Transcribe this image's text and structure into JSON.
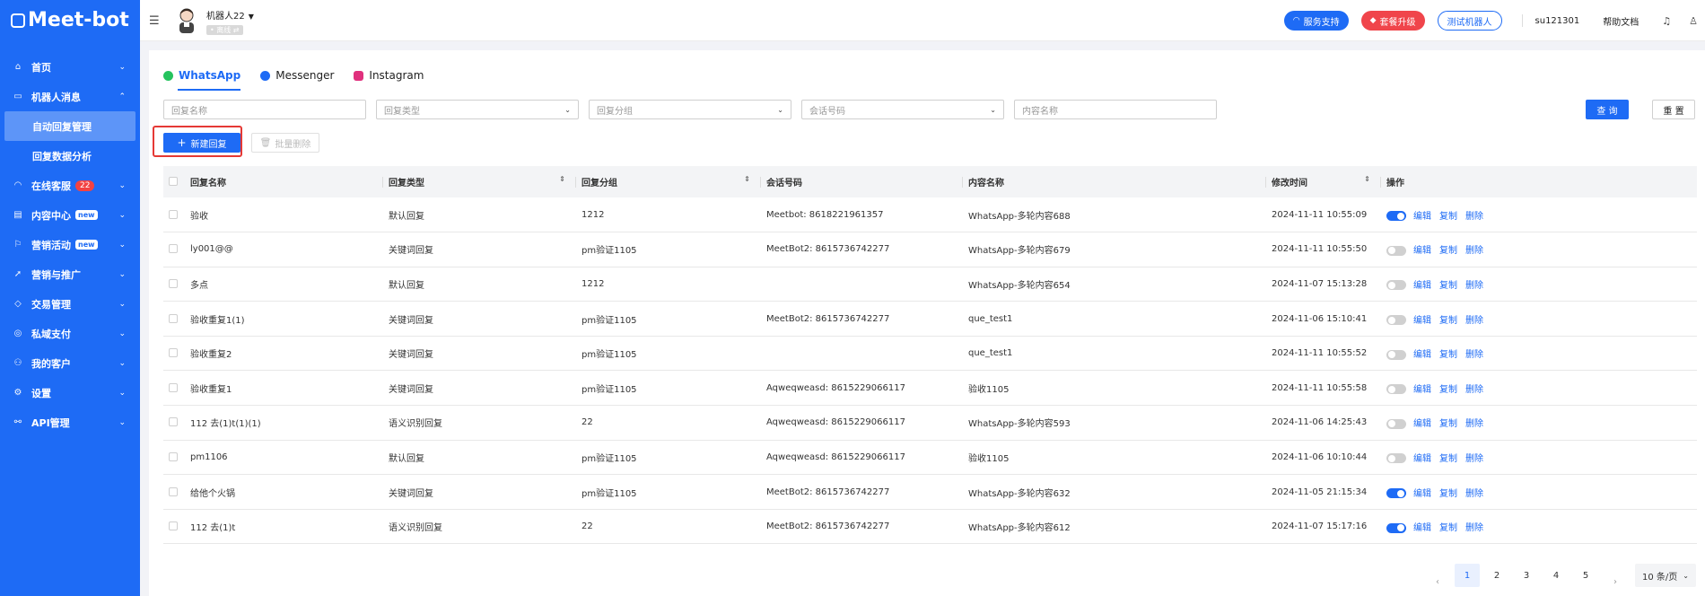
{
  "app": {
    "logo_text": "Meet-bot"
  },
  "sidebar": {
    "items": [
      {
        "label": "首页",
        "icon": "home-icon",
        "glyph": "⌂",
        "chev": "⌄"
      },
      {
        "label": "机器人消息",
        "icon": "robot-message-icon",
        "glyph": "▭",
        "chev": "⌃",
        "children": [
          {
            "label": "自动回复管理",
            "active": true
          },
          {
            "label": "回复数据分析"
          }
        ]
      },
      {
        "label": "在线客服",
        "icon": "headset-icon",
        "glyph": "◠",
        "chev": "⌄",
        "badge": "22"
      },
      {
        "label": "内容中心",
        "icon": "content-icon",
        "glyph": "▤",
        "chev": "⌄",
        "new": "new"
      },
      {
        "label": "营销活动",
        "icon": "marketing-icon",
        "glyph": "⚐",
        "chev": "⌄",
        "new": "new"
      },
      {
        "label": "营销与推广",
        "icon": "promote-icon",
        "glyph": "➚",
        "chev": "⌄"
      },
      {
        "label": "交易管理",
        "icon": "trade-icon",
        "glyph": "◇",
        "chev": "⌄"
      },
      {
        "label": "私域支付",
        "icon": "pay-icon",
        "glyph": "◎",
        "chev": "⌄"
      },
      {
        "label": "我的客户",
        "icon": "customer-icon",
        "glyph": "⚇",
        "chev": "⌄"
      },
      {
        "label": "设置",
        "icon": "settings-icon",
        "glyph": "⚙",
        "chev": "⌄"
      },
      {
        "label": "API管理",
        "icon": "api-icon",
        "glyph": "⚯",
        "chev": "⌄"
      }
    ]
  },
  "header": {
    "bot_name": "机器人22",
    "bot_status": "• 离线 ⇄",
    "support_label": "服务支持",
    "upgrade_label": "套餐升级",
    "test_bot_label": "测试机器人",
    "username": "su121301",
    "help_label": "帮助文档"
  },
  "tabs": [
    {
      "label": "WhatsApp",
      "active": true
    },
    {
      "label": "Messenger"
    },
    {
      "label": "Instagram"
    }
  ],
  "filters": {
    "reply_name": "回复名称",
    "reply_type": "回复类型",
    "reply_group": "回复分组",
    "session_number": "会话号码",
    "content_name": "内容名称",
    "query_label": "查 询",
    "reset_label": "重 置"
  },
  "toolbar": {
    "new_label": "新建回复",
    "bulk_delete_label": "批量删除"
  },
  "table": {
    "columns": [
      "回复名称",
      "回复类型",
      "回复分组",
      "会话号码",
      "内容名称",
      "修改时间",
      "操作"
    ],
    "actions": {
      "edit": "编辑",
      "copy": "复制",
      "delete": "删除"
    },
    "rows": [
      {
        "name": "验收",
        "type": "默认回复",
        "group": "1212",
        "session": "Meetbot: 8618221961357",
        "content": "WhatsApp-多轮内容688",
        "time": "2024-11-11 10:55:09",
        "enabled": true
      },
      {
        "name": "ly001@@",
        "type": "关键词回复",
        "group": "pm验证1105",
        "session": "MeetBot2: 8615736742277",
        "content": "WhatsApp-多轮内容679",
        "time": "2024-11-11 10:55:50",
        "enabled": false
      },
      {
        "name": "多点",
        "type": "默认回复",
        "group": "1212",
        "session": "",
        "content": "WhatsApp-多轮内容654",
        "time": "2024-11-07 15:13:28",
        "enabled": false
      },
      {
        "name": "验收重复1(1)",
        "type": "关键词回复",
        "group": "pm验证1105",
        "session": "MeetBot2: 8615736742277",
        "content": "que_test1",
        "time": "2024-11-06 15:10:41",
        "enabled": false
      },
      {
        "name": "验收重复2",
        "type": "关键词回复",
        "group": "pm验证1105",
        "session": "",
        "content": "que_test1",
        "time": "2024-11-11 10:55:52",
        "enabled": false
      },
      {
        "name": "验收重复1",
        "type": "关键词回复",
        "group": "pm验证1105",
        "session": "Aqweqweasd: 8615229066117",
        "content": "验收1105",
        "time": "2024-11-11 10:55:58",
        "enabled": false
      },
      {
        "name": "112 去(1)t(1)(1)",
        "type": "语义识别回复",
        "group": "22",
        "session": "Aqweqweasd: 8615229066117",
        "content": "WhatsApp-多轮内容593",
        "time": "2024-11-06 14:25:43",
        "enabled": false
      },
      {
        "name": "pm1106",
        "type": "默认回复",
        "group": "pm验证1105",
        "session": "Aqweqweasd: 8615229066117",
        "content": "验收1105",
        "time": "2024-11-06 10:10:44",
        "enabled": false
      },
      {
        "name": "给他个火锅",
        "type": "关键词回复",
        "group": "pm验证1105",
        "session": "MeetBot2: 8615736742277",
        "content": "WhatsApp-多轮内容632",
        "time": "2024-11-05 21:15:34",
        "enabled": true
      },
      {
        "name": "112 去(1)t",
        "type": "语义识别回复",
        "group": "22",
        "session": "MeetBot2: 8615736742277",
        "content": "WhatsApp-多轮内容612",
        "time": "2024-11-07 15:17:16",
        "enabled": true
      }
    ]
  },
  "pagination": {
    "prev": "‹",
    "next": "›",
    "pages": [
      "1",
      "2",
      "3",
      "4",
      "5"
    ],
    "current": "1",
    "page_size": "10 条/页"
  }
}
